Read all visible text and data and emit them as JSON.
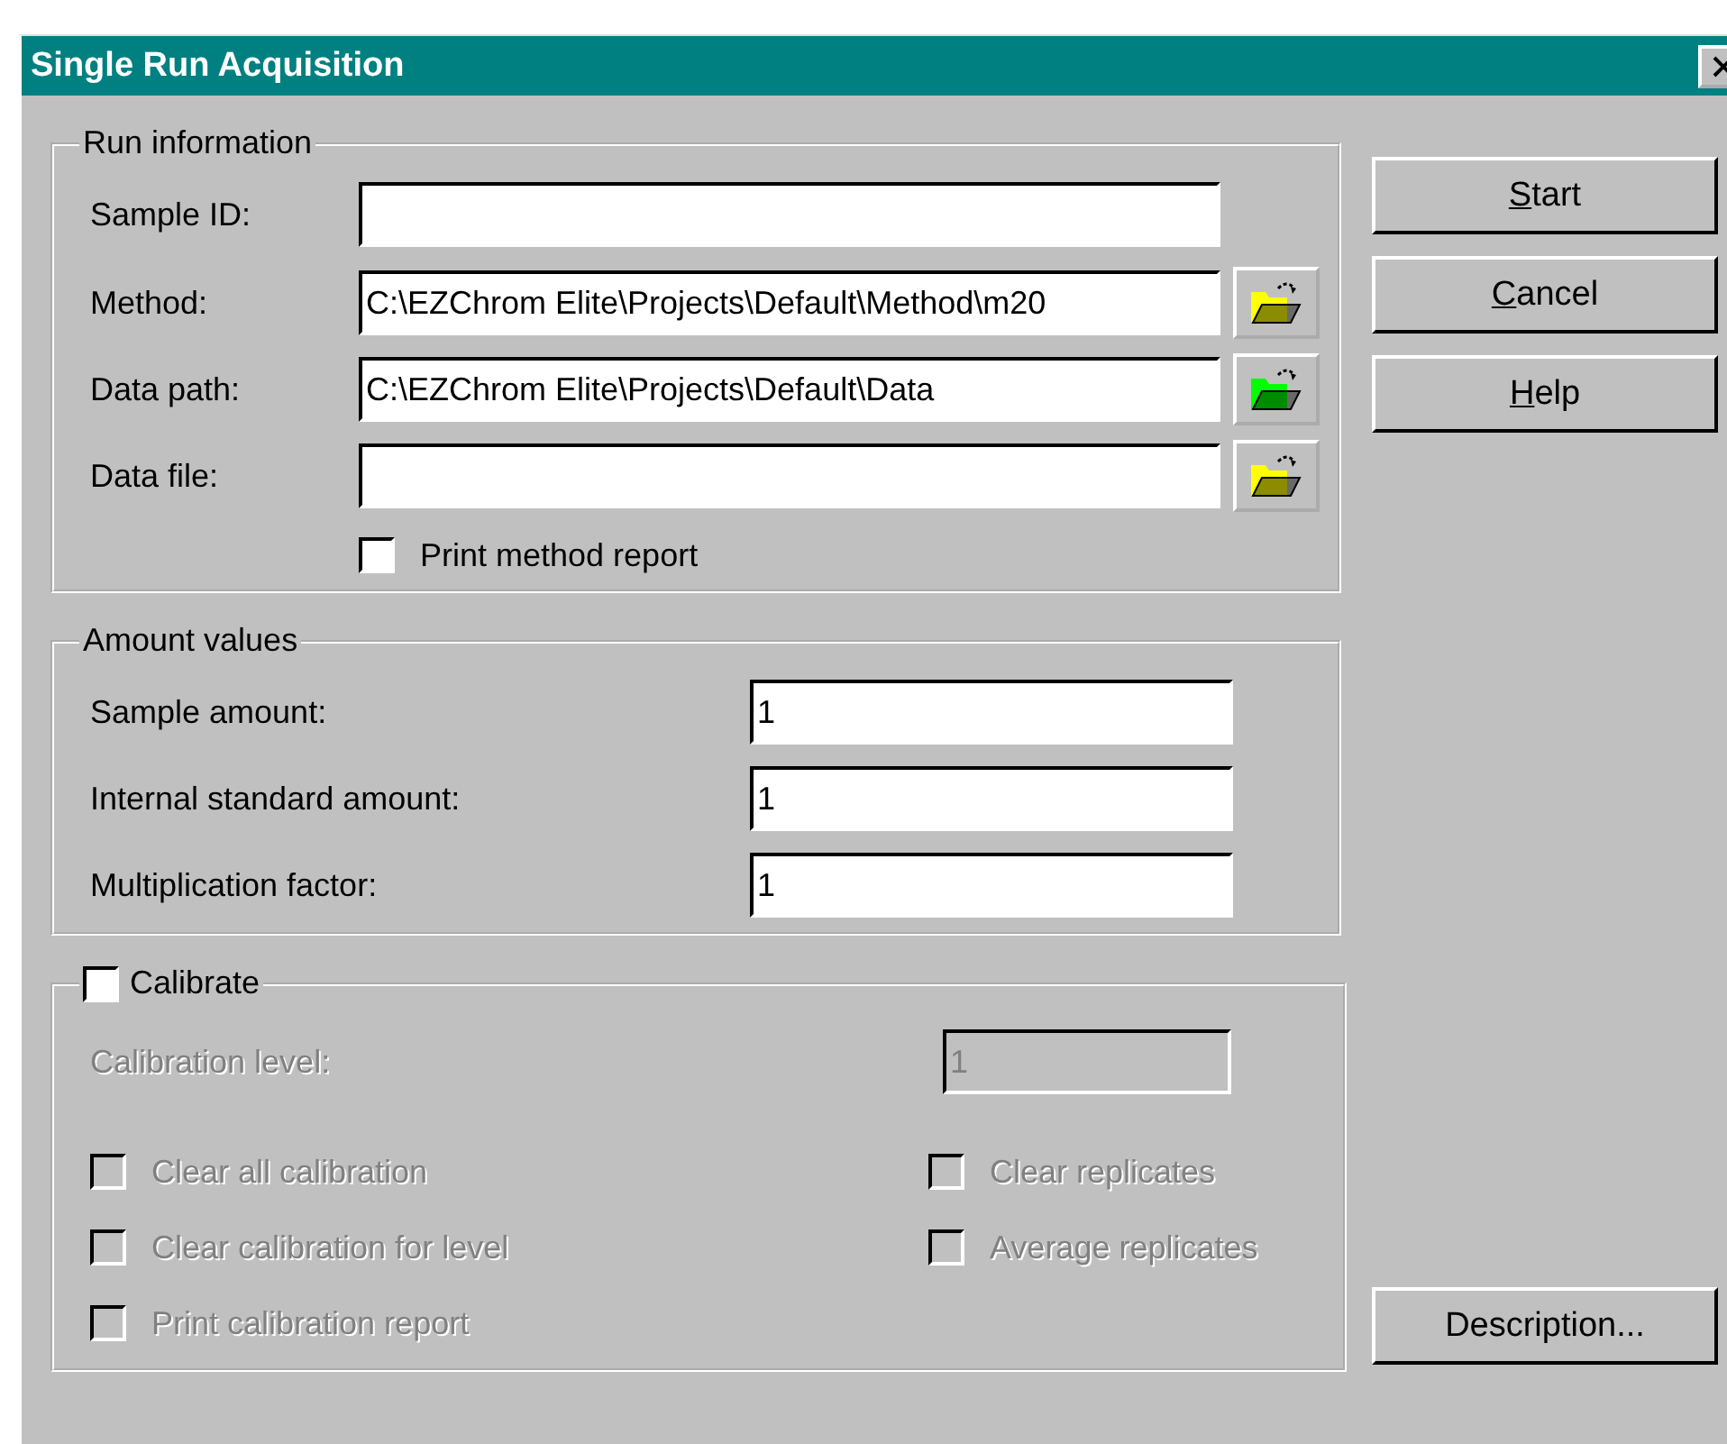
{
  "window": {
    "title": "Single Run Acquisition"
  },
  "run_information": {
    "title": "Run information",
    "fields": [
      {
        "label": "Sample ID:",
        "kind": "plain"
      },
      {
        "label": "Method:",
        "value": "C:\\EZChrom Elite\\Projects\\Default\\Method\\m20",
        "kind": "browse",
        "color": "#ffff00"
      },
      {
        "label": "Data path:",
        "value": "C:\\EZChrom Elite\\Projects\\Default\\Data",
        "kind": "browse",
        "color": "#00ff00"
      },
      {
        "label": "Data file:",
        "kind": "browse",
        "color": "#ffff00"
      }
    ],
    "print_method_report": {
      "label": "Print method report",
      "checked": false
    }
  },
  "amount_values": {
    "title": "Amount values",
    "fields": [
      {
        "label": "Sample amount:",
        "value": "1"
      },
      {
        "label": "Internal standard amount:",
        "value": "1"
      },
      {
        "label": "Multiplication factor:",
        "value": "1"
      }
    ]
  },
  "calibrate": {
    "title": "Calibrate",
    "checked": false,
    "calibration_level": {
      "label": "Calibration level:",
      "value": "1",
      "disabled": true
    },
    "left_options": [
      {
        "label": "Clear all calibration",
        "checked": false,
        "disabled": true
      },
      {
        "label": "Clear calibration for level",
        "checked": false,
        "disabled": true
      },
      {
        "label": "Print calibration report",
        "checked": false,
        "disabled": true
      }
    ],
    "right_options": [
      {
        "label": "Clear replicates",
        "checked": false,
        "disabled": true
      },
      {
        "label": "Average replicates",
        "checked": false,
        "disabled": true
      }
    ]
  },
  "buttons": [
    {
      "mnemonic": "S",
      "rest": "tart"
    },
    {
      "mnemonic": "C",
      "rest": "ancel"
    },
    {
      "mnemonic": "H",
      "rest": "elp"
    }
  ],
  "bottom_button": {
    "rest": "Description..."
  }
}
